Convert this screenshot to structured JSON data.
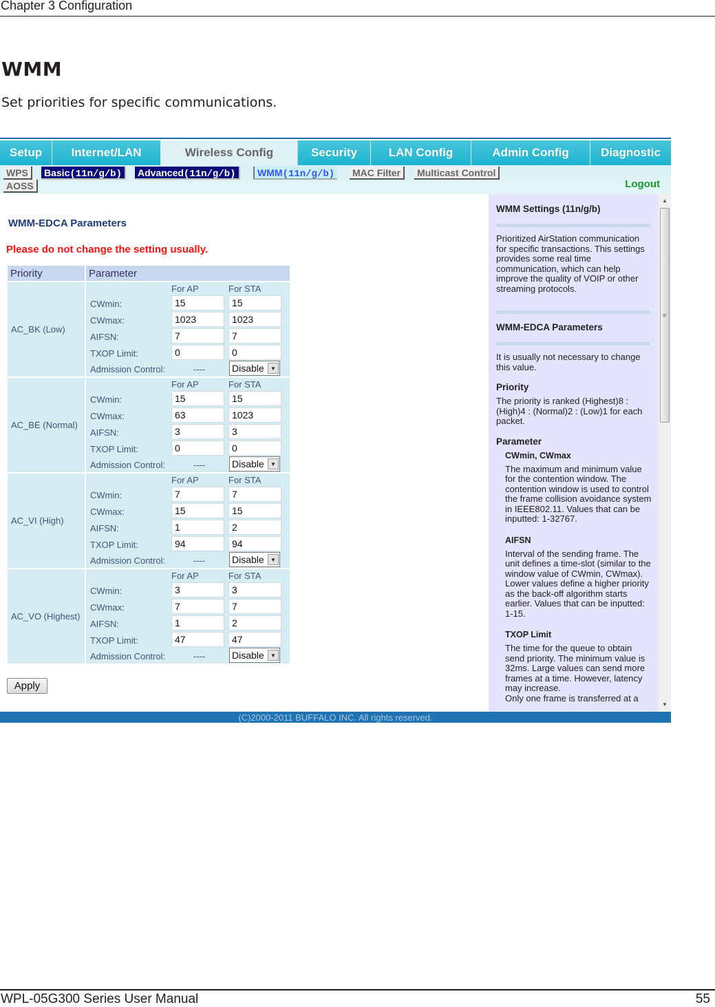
{
  "page_header": "Chapter 3  Configuration",
  "doc_title": "WMM",
  "doc_description": "Set priorities for specific communications.",
  "page_footer": {
    "manual": "WPL-05G300 Series User Manual",
    "page_number": "55"
  },
  "screenshot": {
    "top_nav": [
      {
        "label": "Setup",
        "active": false
      },
      {
        "label": "Internet/LAN",
        "active": false
      },
      {
        "label": "Wireless Config",
        "active": true
      },
      {
        "label": "Security",
        "active": false
      },
      {
        "label": "LAN Config",
        "active": false
      },
      {
        "label": "Admin Config",
        "active": false
      },
      {
        "label": "Diagnostic",
        "active": false
      }
    ],
    "sub_nav": {
      "wps": "WPS",
      "basic": "Basic",
      "basic_suffix": "(11n/g/b)",
      "advanced": "Advanced",
      "advanced_suffix": "(11n/g/b)",
      "wmm": "WMM",
      "wmm_suffix": "(11n/g/b)",
      "mac_filter": "MAC Filter",
      "multicast": "Multicast Control",
      "aoss": "AOSS",
      "logout": "Logout"
    },
    "main": {
      "section_title": "WMM-EDCA Parameters",
      "warning": "Please do not change the setting usually.",
      "table_headers": {
        "priority": "Priority",
        "parameter": "Parameter"
      },
      "col_for_ap": "For AP",
      "col_for_sta": "For STA",
      "labels": {
        "cwmin": "CWmin:",
        "cwmax": "CWmax:",
        "aifsn": "AIFSN:",
        "txop": "TXOP Limit:",
        "admission": "Admission Control:"
      },
      "admission_ap": "----",
      "rows": [
        {
          "priority": "AC_BK (Low)",
          "ap": {
            "cwmin": "15",
            "cwmax": "1023",
            "aifsn": "7",
            "txop": "0"
          },
          "sta": {
            "cwmin": "15",
            "cwmax": "1023",
            "aifsn": "7",
            "txop": "0"
          },
          "admission": "Disable"
        },
        {
          "priority": "AC_BE (Normal)",
          "ap": {
            "cwmin": "15",
            "cwmax": "63",
            "aifsn": "3",
            "txop": "0"
          },
          "sta": {
            "cwmin": "15",
            "cwmax": "1023",
            "aifsn": "3",
            "txop": "0"
          },
          "admission": "Disable"
        },
        {
          "priority": "AC_VI (High)",
          "ap": {
            "cwmin": "7",
            "cwmax": "15",
            "aifsn": "1",
            "txop": "94"
          },
          "sta": {
            "cwmin": "7",
            "cwmax": "15",
            "aifsn": "2",
            "txop": "94"
          },
          "admission": "Disable"
        },
        {
          "priority": "AC_VO (Highest)",
          "ap": {
            "cwmin": "3",
            "cwmax": "7",
            "aifsn": "1",
            "txop": "47"
          },
          "sta": {
            "cwmin": "3",
            "cwmax": "7",
            "aifsn": "2",
            "txop": "47"
          },
          "admission": "Disable"
        }
      ],
      "apply_label": "Apply"
    },
    "help": {
      "title": "WMM Settings (11n/g/b)",
      "intro": "Prioritized AirStation communication for specific transactions. This settings provides some real time communication, which can help improve the quality of VOIP or other streaming protocols.",
      "edca_title": "WMM-EDCA Parameters",
      "edca_text": "It is usually not necessary to change this value.",
      "priority_title": "Priority",
      "priority_text": "The priority is ranked (Highest)8 : (High)4 : (Normal)2 : (Low)1 for each packet.",
      "parameter_title": "Parameter",
      "cw_title": "CWmin, CWmax",
      "cw_text": "The maximum and minimum value for the contention window. The contention window is used to control the frame collision avoidance system in IEEE802.11. Values that can be inputted: 1-32767.",
      "aifsn_title": "AIFSN",
      "aifsn_text": "Interval of the sending frame. The unit defines a time-slot (similar to the window value of CWmin, CWmax). Lower values define a higher priority as the back-off algorithm starts earlier. Values that can be inputted: 1-15.",
      "txop_title": "TXOP Limit",
      "txop_text": "The time for the queue to obtain send priority. The minimum value is 32ms. Large values can send more frames at a time. However, latency may increase.",
      "txop_text_cut": "Only one frame is transferred at a"
    },
    "copyright": "(C)2000-2011 BUFFALO INC. All rights reserved.",
    "colors": {
      "nav_tab": "#1cb4cf",
      "sub_tab_dark": "#0a0a7a",
      "warning": "#ff1010",
      "logout": "#1a9a2a",
      "help_bg": "#e4e4fc",
      "footer_bar": "#1f73b2"
    }
  }
}
